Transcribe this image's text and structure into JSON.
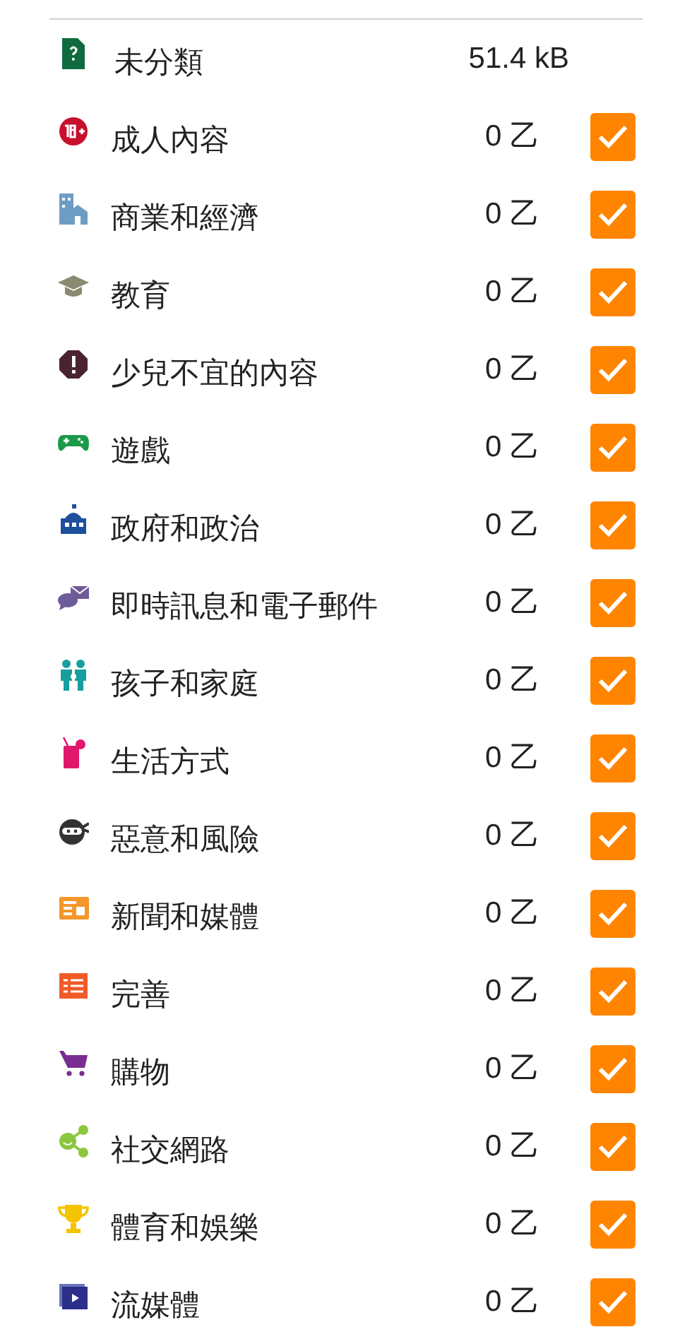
{
  "categories": [
    {
      "label": "未分類",
      "size": "51.4 kB"
    },
    {
      "label": "成人內容",
      "size": "0 乙",
      "checked": true
    },
    {
      "label": "商業和經濟",
      "size": "0 乙",
      "checked": true
    },
    {
      "label": "教育",
      "size": "0 乙",
      "checked": true
    },
    {
      "label": "少兒不宜的內容",
      "size": "0 乙",
      "checked": true
    },
    {
      "label": "遊戲",
      "size": "0 乙",
      "checked": true
    },
    {
      "label": "政府和政治",
      "size": "0 乙",
      "checked": true
    },
    {
      "label": "即時訊息和電子郵件",
      "size": "0 乙",
      "checked": true
    },
    {
      "label": "孩子和家庭",
      "size": "0 乙",
      "checked": true
    },
    {
      "label": "生活方式",
      "size": "0 乙",
      "checked": true
    },
    {
      "label": "惡意和風險",
      "size": "0 乙",
      "checked": true
    },
    {
      "label": "新聞和媒體",
      "size": "0 乙",
      "checked": true
    },
    {
      "label": "完善",
      "size": "0 乙",
      "checked": true
    },
    {
      "label": "購物",
      "size": "0 乙",
      "checked": true
    },
    {
      "label": "社交網路",
      "size": "0 乙",
      "checked": true
    },
    {
      "label": "體育和娛樂",
      "size": "0 乙",
      "checked": true
    },
    {
      "label": "流媒體",
      "size": "0 乙",
      "checked": true
    }
  ]
}
